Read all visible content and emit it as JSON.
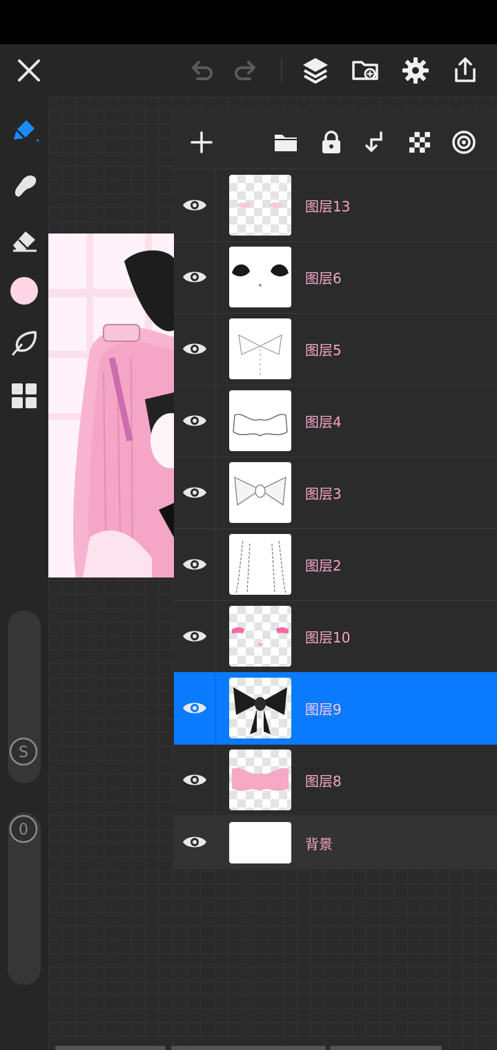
{
  "app": {
    "accent": "#0a7bff",
    "brush_color": "#ffd6e6"
  },
  "topbar": {
    "icons": [
      "close-icon",
      "undo-icon",
      "redo-icon",
      "layers-icon",
      "gallery-icon",
      "gear-icon",
      "share-icon"
    ]
  },
  "tools": [
    "pen-icon",
    "smudge-icon",
    "eraser-icon",
    "color-swatch",
    "lasso-icon",
    "grid-icon"
  ],
  "sliders": {
    "size_label": "S",
    "opacity_label": "0"
  },
  "layers_panel": {
    "toolbar_icons": [
      "add-icon",
      "folder-icon",
      "lock-icon",
      "merge-down-icon",
      "transparency-lock-icon",
      "blend-icon"
    ],
    "layers": [
      {
        "name": "图层13",
        "visible": true,
        "selected": false
      },
      {
        "name": "图层6",
        "visible": true,
        "selected": false
      },
      {
        "name": "图层5",
        "visible": true,
        "selected": false
      },
      {
        "name": "图层4",
        "visible": true,
        "selected": false
      },
      {
        "name": "图层3",
        "visible": true,
        "selected": false
      },
      {
        "name": "图层2",
        "visible": true,
        "selected": false
      },
      {
        "name": "图层10",
        "visible": true,
        "selected": false
      },
      {
        "name": "图层9",
        "visible": true,
        "selected": true
      },
      {
        "name": "图层8",
        "visible": true,
        "selected": false
      }
    ],
    "background": {
      "name": "背景",
      "visible": true
    }
  }
}
